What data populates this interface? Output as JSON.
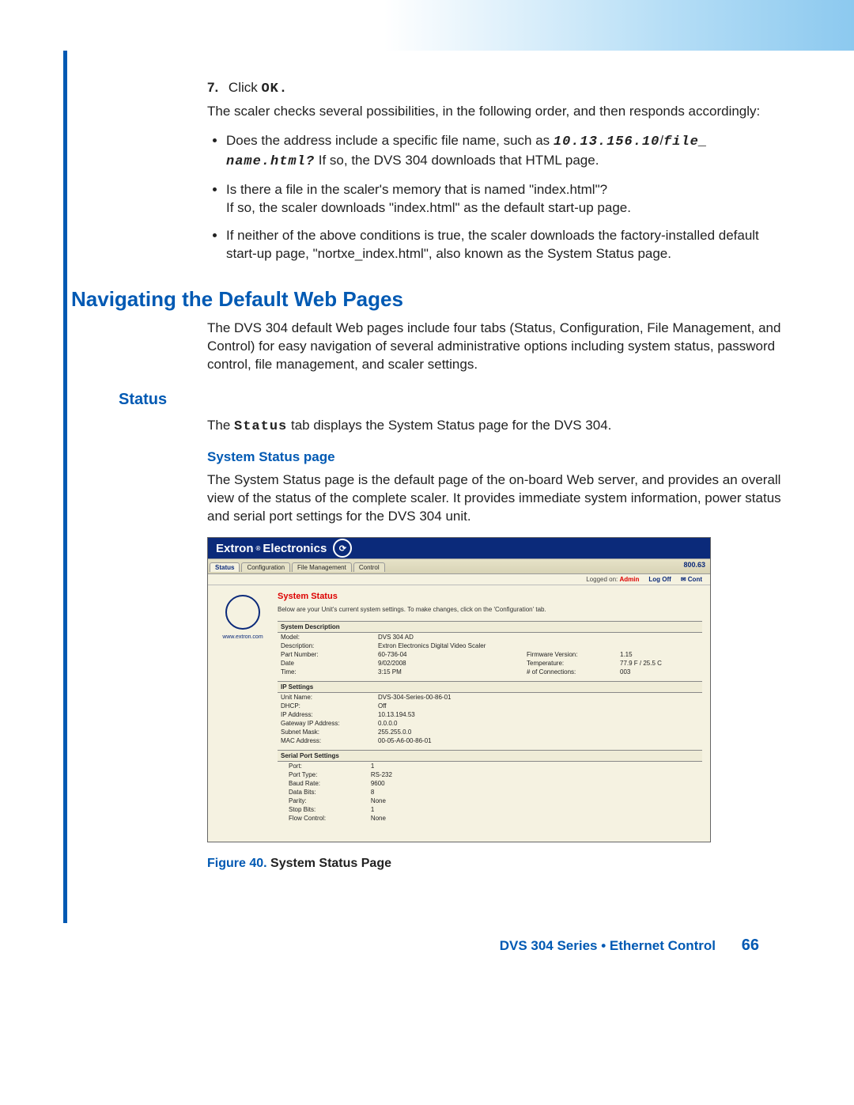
{
  "step7": {
    "num": "7.",
    "prefix": "Click ",
    "action": "OK."
  },
  "para1": "The scaler checks several possibilities, in the following order, and then responds accordingly:",
  "bullets": {
    "b1a": "Does the address include a specific file name, such as ",
    "b1code1": "10.13.156.10",
    "b1slash": "/",
    "b1code2": "file_ name.html?",
    "b1b": "  If so, the DVS 304 downloads that HTML page.",
    "b2a": "Is there a file in the scaler's memory that is named \"index.html\"?",
    "b2b": "If so, the scaler downloads \"index.html\" as the default start-up page.",
    "b3": "If neither of the above conditions is true, the scaler downloads the factory-installed default start-up page, \"nortxe_index.html\", also known as the System Status page."
  },
  "h1": "Navigating the Default Web Pages",
  "para2": "The DVS 304 default Web pages include four tabs (Status, Configuration, File Management, and Control) for easy navigation of several administrative options including system status, password control, file management, and scaler settings.",
  "h2": "Status",
  "para3a": "The ",
  "para3code": "Status",
  "para3b": " tab displays the System Status page for the DVS 304.",
  "h3": "System Status page",
  "para4": "The System Status page is the default page of the on-board Web server, and provides an overall view of the status of the complete scaler. It provides immediate system information, power status and serial port settings for the DVS 304 unit.",
  "screenshot": {
    "brand1": "Extron",
    "brand2": "Electronics",
    "tabs": [
      "Status",
      "Configuration",
      "File Management",
      "Control"
    ],
    "phone": "800.63",
    "logged_label": "Logged on:",
    "logged_user": "Admin",
    "logoff": "Log Off",
    "contact": "Cont",
    "side_url": "www.extron.com",
    "title": "System Status",
    "desc": "Below are your Unit's current system settings. To make changes, click on the 'Configuration' tab.",
    "group1": "System Description",
    "desc1": {
      "model_l": "Model:",
      "model_v": "DVS 304 AD",
      "descr_l": "Description:",
      "descr_v": "Extron Electronics Digital Video Scaler",
      "part_l": "Part Number:",
      "part_v": "60-736-04",
      "fw_l": "Firmware Version:",
      "fw_v": "1.15",
      "date_l": "Date",
      "date_v": "9/02/2008",
      "temp_l": "Temperature:",
      "temp_v": "77.9 F / 25.5 C",
      "time_l": "Time:",
      "time_v": "3:15 PM",
      "conn_l": "# of Connections:",
      "conn_v": "003"
    },
    "group2": "IP Settings",
    "ip": {
      "unit_l": "Unit Name:",
      "unit_v": "DVS-304-Series-00-86-01",
      "dhcp_l": "DHCP:",
      "dhcp_v": "Off",
      "ip_l": "IP Address:",
      "ip_v": "10.13.194.53",
      "gw_l": "Gateway IP Address:",
      "gw_v": "0.0.0.0",
      "mask_l": "Subnet Mask:",
      "mask_v": "255.255.0.0",
      "mac_l": "MAC Address:",
      "mac_v": "00-05-A6-00-86-01"
    },
    "group3": "Serial Port Settings",
    "serial": {
      "port_l": "Port:",
      "port_v": "1",
      "type_l": "Port Type:",
      "type_v": "RS-232",
      "baud_l": "Baud Rate:",
      "baud_v": "9600",
      "data_l": "Data Bits:",
      "data_v": "8",
      "parity_l": "Parity:",
      "parity_v": "None",
      "stop_l": "Stop Bits:",
      "stop_v": "1",
      "flow_l": "Flow Control:",
      "flow_v": "None"
    }
  },
  "figure": {
    "label": "Figure 40.",
    "caption": "System Status Page"
  },
  "footer": {
    "text": "DVS 304 Series • Ethernet Control",
    "page": "66"
  }
}
